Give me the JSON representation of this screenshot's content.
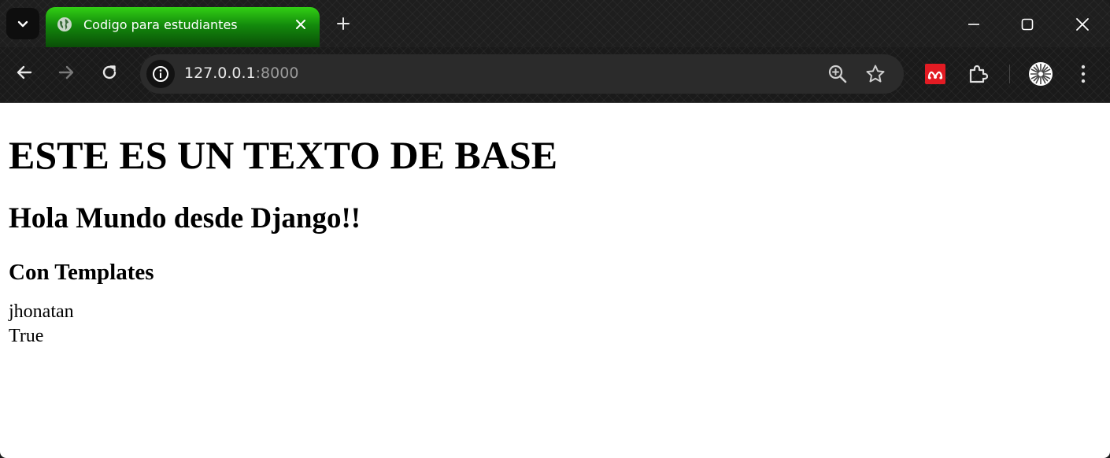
{
  "browser": {
    "tab": {
      "title": "Codigo para estudiantes",
      "favicon": "globe-icon"
    },
    "address": {
      "host": "127.0.0.1",
      "port": ":8000"
    },
    "accent_color": "#1fa80f"
  },
  "page": {
    "h1": "ESTE ES UN TEXTO DE BASE",
    "h2": "Hola Mundo desde Django!!",
    "h3": "Con Templates",
    "lines": [
      "jhonatan",
      "True"
    ]
  }
}
